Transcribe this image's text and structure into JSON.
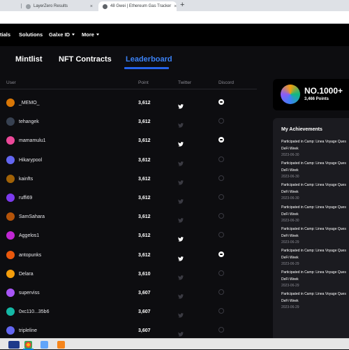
{
  "browser": {
    "tabs": [
      {
        "label": "LayerZero Results"
      },
      {
        "label": "48 Gwei | Ethereum Gas Tracker"
      }
    ],
    "new_tab_symbol": "+",
    "close_symbol": "×"
  },
  "site_nav": {
    "items": [
      {
        "label": "tials"
      },
      {
        "label": "Solutions"
      },
      {
        "label": "Galxe ID"
      },
      {
        "label": "More"
      }
    ]
  },
  "content_tabs": [
    {
      "label": "Mintlist"
    },
    {
      "label": "NFT Contracts"
    },
    {
      "label": "Leaderboard"
    }
  ],
  "table": {
    "columns": [
      "User",
      "Point",
      "Twitter",
      "Discord"
    ],
    "rows": [
      {
        "user": "_MEMO_",
        "points": "3,612",
        "twitter": true,
        "discord": true,
        "avatar_color": "#d97706"
      },
      {
        "user": "tehangek",
        "points": "3,612",
        "twitter": false,
        "discord": false,
        "avatar_color": "#374151"
      },
      {
        "user": "mamamulu1",
        "points": "3,612",
        "twitter": true,
        "discord": true,
        "avatar_color": "#ec4899"
      },
      {
        "user": "Hikarypool",
        "points": "3,612",
        "twitter": false,
        "discord": false,
        "avatar_color": "#6366f1"
      },
      {
        "user": "kainfts",
        "points": "3,612",
        "twitter": false,
        "discord": false,
        "avatar_color": "#a16207"
      },
      {
        "user": "ruffi69",
        "points": "3,612",
        "twitter": false,
        "discord": false,
        "avatar_color": "#7c3aed"
      },
      {
        "user": "SamSahara",
        "points": "3,612",
        "twitter": false,
        "discord": false,
        "avatar_color": "#b45309"
      },
      {
        "user": "Aggelos1",
        "points": "3,612",
        "twitter": true,
        "discord": false,
        "avatar_color": "#c026d3"
      },
      {
        "user": "antopunks",
        "points": "3,612",
        "twitter": true,
        "discord": true,
        "avatar_color": "#ea580c"
      },
      {
        "user": "Delara",
        "points": "3,610",
        "twitter": false,
        "discord": false,
        "avatar_color": "#f59e0b"
      },
      {
        "user": "superviss",
        "points": "3,607",
        "twitter": false,
        "discord": false,
        "avatar_color": "#a855f7"
      },
      {
        "user": "0xc110...35b6",
        "points": "3,607",
        "twitter": false,
        "discord": false,
        "avatar_color": "#14b8a6"
      },
      {
        "user": "tripleline",
        "points": "3,607",
        "twitter": false,
        "discord": false,
        "avatar_color": "#6366f1"
      }
    ]
  },
  "rank_card": {
    "rank": "NO.1000+",
    "points": "3,466 Points"
  },
  "achievements": {
    "title": "My Achievements",
    "items": [
      {
        "line1": "Participated in Camp: Linea Voyage Ques",
        "line2": "DeFi Week",
        "date": "2023-06-30"
      },
      {
        "line1": "Participated in Camp: Linea Voyage Ques",
        "line2": "DeFi Week",
        "date": "2023-06-30"
      },
      {
        "line1": "Participated in Camp: Linea Voyage Ques",
        "line2": "DeFi Week",
        "date": "2023-06-30"
      },
      {
        "line1": "Participated in Camp: Linea Voyage Ques",
        "line2": "DeFi Week",
        "date": "2023-06-30"
      },
      {
        "line1": "Participated in Camp: Linea Voyage Ques",
        "line2": "DeFi Week",
        "date": "2023-06-29"
      },
      {
        "line1": "Participated in Camp: Linea Voyage Ques",
        "line2": "DeFi Week",
        "date": "2023-06-29"
      },
      {
        "line1": "Participated in Camp: Linea Voyage Ques",
        "line2": "DeFi Week",
        "date": "2023-06-29"
      },
      {
        "line1": "Participated in Camp: Linea Voyage Ques",
        "line2": "DeFi Week",
        "date": "2023-06-29"
      }
    ]
  },
  "colors": {
    "accent": "#2563eb",
    "background": "#0d0d10",
    "panel": "#1b1b20"
  }
}
